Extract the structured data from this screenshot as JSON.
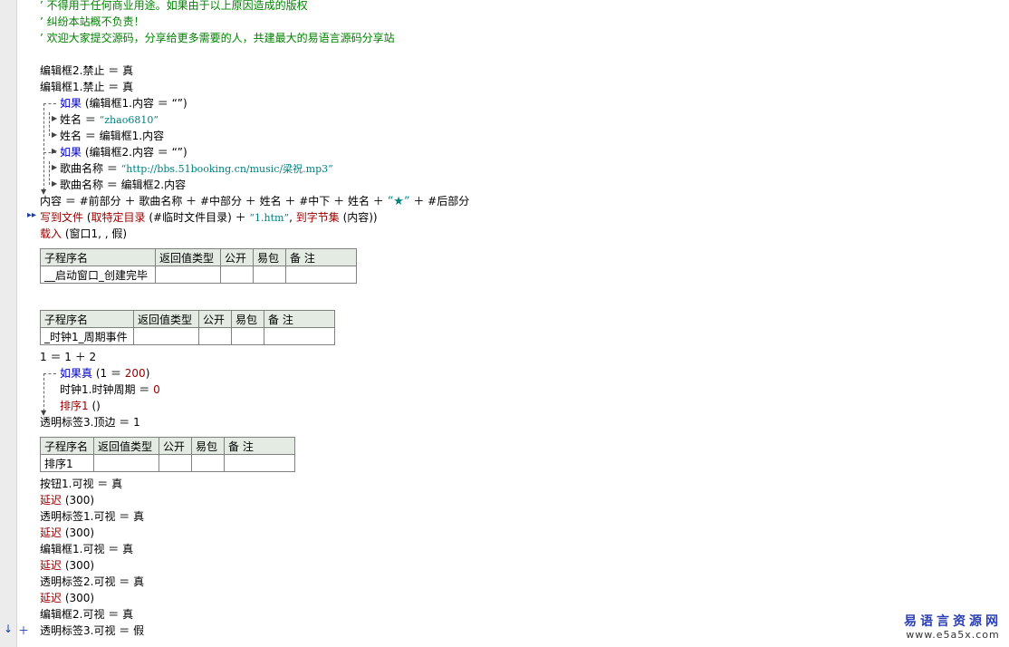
{
  "comments": [
    "’ 不得用于任何商业用途。如果由于以上原因造成的版权",
    "’ 纠纷本站概不负责！",
    "’ 欢迎大家提交源码，分享给更多需要的人，共建最大的易语言源码分享站"
  ],
  "code": {
    "l1": "编辑框2.禁止 ＝ 真",
    "l2": "编辑框1.禁止 ＝ 真",
    "if1_kw": "如果",
    "if1_rest": " (编辑框1.内容 ＝ “”)",
    "name_a": "姓名 ＝ ",
    "name_a_str": "“zhao6810”",
    "name_b": "姓名 ＝ 编辑框1.内容",
    "if2_kw": "如果",
    "if2_rest": " (编辑框2.内容 ＝ “”)",
    "song_a": "歌曲名称 ＝ ",
    "song_a_str": "“http://bbs.51booking.cn/music/梁祝.mp3”",
    "song_b": "歌曲名称 ＝ 编辑框2.内容",
    "content_a": "内容 ＝ #前部分 ＋ 歌曲名称 ＋ #中部分 ＋ 姓名 ＋ #中下 ＋ 姓名 ＋ ",
    "content_star": "“★”",
    "content_b": " ＋ #后部分",
    "write_fn": "写到文件",
    "write_a": " (",
    "write_fn2": "取特定目录",
    "write_b": " (#临时文件目录) ＋ ",
    "write_str": "“1.htm”",
    "write_c": ", ",
    "write_fn3": "到字节集",
    "write_d": " (内容))",
    "load_fn": "载入",
    "load_rest": " (窗口1, , 假)",
    "s2_l1": "1 ＝ 1 ＋ 2",
    "s2_if_kw": "如果真",
    "s2_if_a": " (1 ＝ ",
    "s2_if_num": "200",
    "s2_if_b": ")",
    "s2_timer": "时钟1.时钟周期 ＝ ",
    "s2_timer_num": "0",
    "s2_sort": "排序1",
    "s2_sort_rest": " ()",
    "s2_top": "透明标签3.顶边 ＝ 1",
    "s3_btn": "按钮1.可视 ＝ 真",
    "delay_fn": "延迟",
    "delay_arg": " (300)",
    "s3_lbl1": "透明标签1.可视 ＝ 真",
    "s3_edit1": "编辑框1.可视 ＝ 真",
    "s3_lbl2": "透明标签2.可视 ＝ 真",
    "s3_edit2": "编辑框2.可视 ＝ 真",
    "s3_lbl3": "透明标签3.可视 ＝ 假"
  },
  "table_headers": [
    "子程序名",
    "返回值类型",
    "公开",
    "易包",
    "备 注"
  ],
  "subs": [
    "__启动窗口_创建完毕",
    "_时钟1_周期事件",
    "排序1"
  ],
  "markers": {
    "exec": "▸▸",
    "down": "↓",
    "plus": "＋"
  },
  "watermark": {
    "brand": "易语言资源网",
    "url": "www.e5a5x.com"
  }
}
